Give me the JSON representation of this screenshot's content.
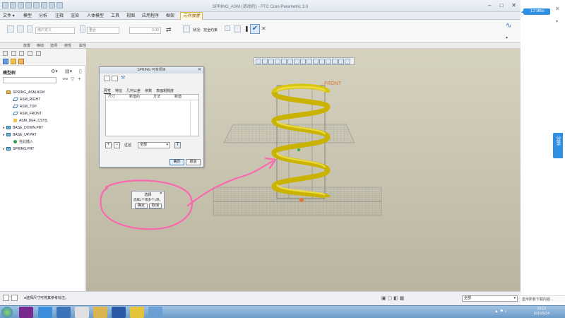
{
  "window": {
    "title": "SPRING_ASM (活动的) - PTC Creo Parametric 3.0",
    "controls": [
      "–",
      "□",
      "✕"
    ]
  },
  "menu": {
    "tabs": [
      "文件 ▾",
      "模型",
      "分析",
      "注释",
      "渲染",
      "人体模型",
      "工具",
      "视图",
      "应用程序",
      "框架",
      "元件放置"
    ],
    "active_tab": "元件放置"
  },
  "ribbon": {
    "placement_type": "用户定义",
    "constraint": "重合",
    "offset_value": "0.00",
    "status_label": "状况:",
    "status_value": "完全约束"
  },
  "subtabs": [
    "放置",
    "移动",
    "选项",
    "挠性",
    "属性"
  ],
  "model_tree": {
    "title": "模型树",
    "items": [
      {
        "label": "SPRING_ASM.ASM",
        "icon": "assembly-icon",
        "expandable": false,
        "indent": 0
      },
      {
        "label": "ASM_RIGHT",
        "icon": "datum-plane-icon",
        "expandable": false,
        "indent": 1
      },
      {
        "label": "ASM_TOP",
        "icon": "datum-plane-icon",
        "expandable": false,
        "indent": 1
      },
      {
        "label": "ASM_FRONT",
        "icon": "datum-plane-icon",
        "expandable": false,
        "indent": 1
      },
      {
        "label": "ASM_DEF_CSYS",
        "icon": "csys-icon",
        "expandable": false,
        "indent": 1
      },
      {
        "label": "BASE_DOWN.PRT",
        "icon": "part-icon",
        "expandable": true,
        "indent": 0
      },
      {
        "label": "BASE_UP.PRT",
        "icon": "part-icon",
        "expandable": true,
        "indent": 0
      },
      {
        "label": "在此插入",
        "icon": "insert-here-icon",
        "expandable": false,
        "indent": 1
      },
      {
        "label": "SPRING.PRT",
        "icon": "part-icon",
        "expandable": true,
        "indent": 0
      }
    ]
  },
  "dialog": {
    "title": "SPRING    可变项目",
    "tabs": [
      "尺寸",
      "特征",
      "几何公差",
      "参数",
      "表面粗糙度"
    ],
    "active_tab": "尺寸",
    "columns": [
      "尺寸",
      "新值的",
      "方法",
      "新值"
    ],
    "filter_label": "过滤",
    "filter_value": "全部",
    "ok": "确定",
    "cancel": "取消"
  },
  "select_popup": {
    "title": "选择",
    "prompt": "选择1个或多个1项。",
    "ok": "确定",
    "cancel": "取消"
  },
  "canvas": {
    "datum_label": "FRONT"
  },
  "status": {
    "message": "●选择尺寸可将其参考标注。",
    "filter": "全部"
  },
  "side_panel": {
    "tab": "分享",
    "hint": "显示所有下载内容...",
    "badge": "1.2 MB/s"
  },
  "taskbar": {
    "time": "12:12",
    "date": "2015/5/24"
  },
  "colors": {
    "spring": "#e6d21a",
    "annotation": "#ff6eb4",
    "accent": "#2e8fe3"
  }
}
